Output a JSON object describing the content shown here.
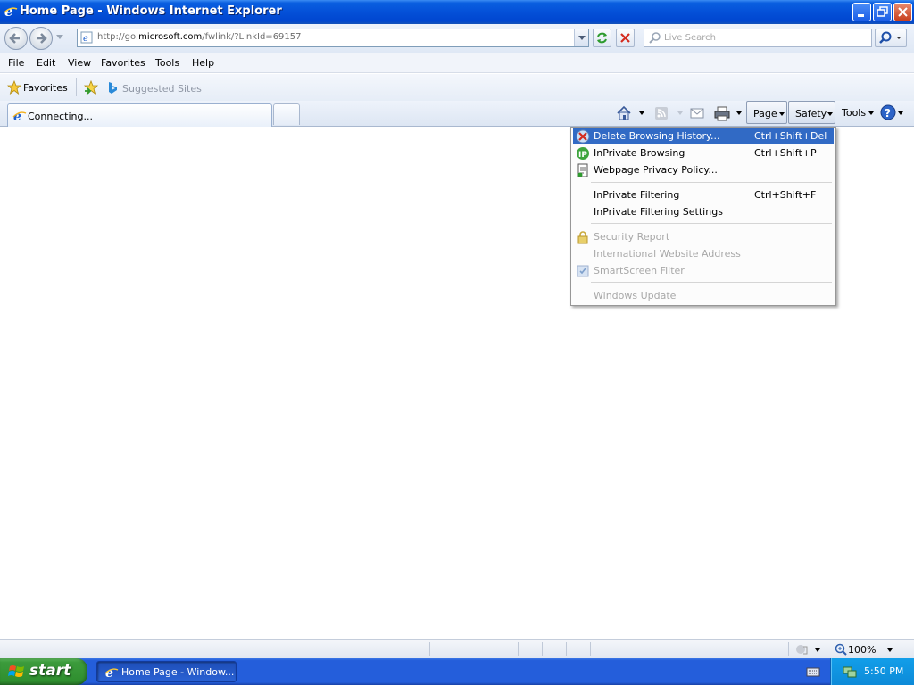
{
  "window": {
    "title": "Home Page - Windows Internet Explorer",
    "buttons": [
      "minimize-icon",
      "restore-icon",
      "close-icon"
    ]
  },
  "navigation": {
    "address_prefix": "http://go.",
    "address_domain": "microsoft.com",
    "address_suffix": "/fwlink/?LinkId=69157",
    "search_placeholder": "Live Search"
  },
  "menubar": {
    "items": [
      "File",
      "Edit",
      "View",
      "Favorites",
      "Tools",
      "Help"
    ]
  },
  "favorites_bar": {
    "favorites_label": "Favorites",
    "suggested_sites_label": "Suggested Sites"
  },
  "tabs": {
    "active_label": "Connecting..."
  },
  "command_bar": {
    "page_label": "Page",
    "safety_label": "Safety",
    "tools_label": "Tools"
  },
  "safety_menu": {
    "items": [
      {
        "label": "Delete Browsing History...",
        "shortcut": "Ctrl+Shift+Del",
        "enabled": true,
        "highlighted": true
      },
      {
        "label": "InPrivate Browsing",
        "shortcut": "Ctrl+Shift+P",
        "enabled": true
      },
      {
        "label": "Webpage Privacy Policy...",
        "shortcut": "",
        "enabled": true
      },
      {
        "label": "InPrivate Filtering",
        "shortcut": "Ctrl+Shift+F",
        "enabled": true
      },
      {
        "label": "InPrivate Filtering Settings",
        "shortcut": "",
        "enabled": true
      },
      {
        "label": "Security Report",
        "shortcut": "",
        "enabled": false
      },
      {
        "label": "International Website Address",
        "shortcut": "",
        "enabled": false
      },
      {
        "label": "SmartScreen Filter",
        "shortcut": "",
        "enabled": false
      },
      {
        "label": "Windows Update",
        "shortcut": "",
        "enabled": false
      }
    ]
  },
  "status_bar": {
    "zoom": "100%"
  },
  "taskbar": {
    "start_label": "start",
    "task_label": "Home Page - Window...",
    "clock": "5:50 PM"
  },
  "colors": {
    "titlebar_blue": "#0450d8",
    "menu_highlight": "#316ac5",
    "start_green": "#3c9b3c",
    "tray_blue": "#0d8ad8"
  }
}
